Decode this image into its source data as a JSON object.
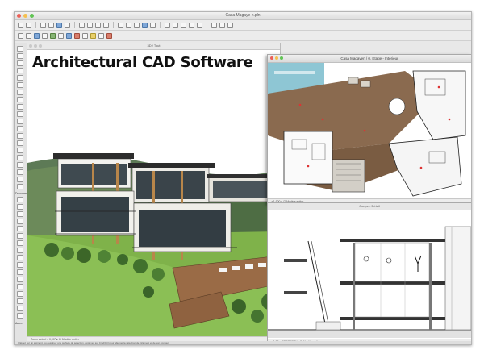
{
  "headline": "Architectural CAD Software",
  "app_window": {
    "title": "Casa Magaye n.pln"
  },
  "window_3d": {
    "title": "3D / Tout",
    "status": "Zoom actuel   ◂  0,00°   ▸  ⊡  Modèle entier"
  },
  "window_plan": {
    "title": "Casa Magayen / 0. Etage - Intérieur",
    "status": "◂ 1:100   ▸  ⊡  Modèle entier"
  },
  "window_section": {
    "title": "Coupe - Détail",
    "status": "◂ 1:50   ▸  PROPERTY...  ⊡  Modèle entier"
  },
  "bottom_hint": "Cliquez sur un élément, ou dessinez une surface de sélection. Appuyez sur Cmd/Ctrl pour alterner la sélection de l'élément et de son contour.",
  "toolbox": {
    "group_labels": [
      "Création",
      "Document",
      "Autres"
    ]
  },
  "colors": {
    "sky": "#ffffff",
    "lawn": "#7fb24a",
    "plan_wood": "#8a6a4f",
    "pool": "#8ec6d4",
    "traffic_red": "#ec5f57",
    "traffic_yellow": "#f5bf4f",
    "traffic_green": "#61c454"
  }
}
